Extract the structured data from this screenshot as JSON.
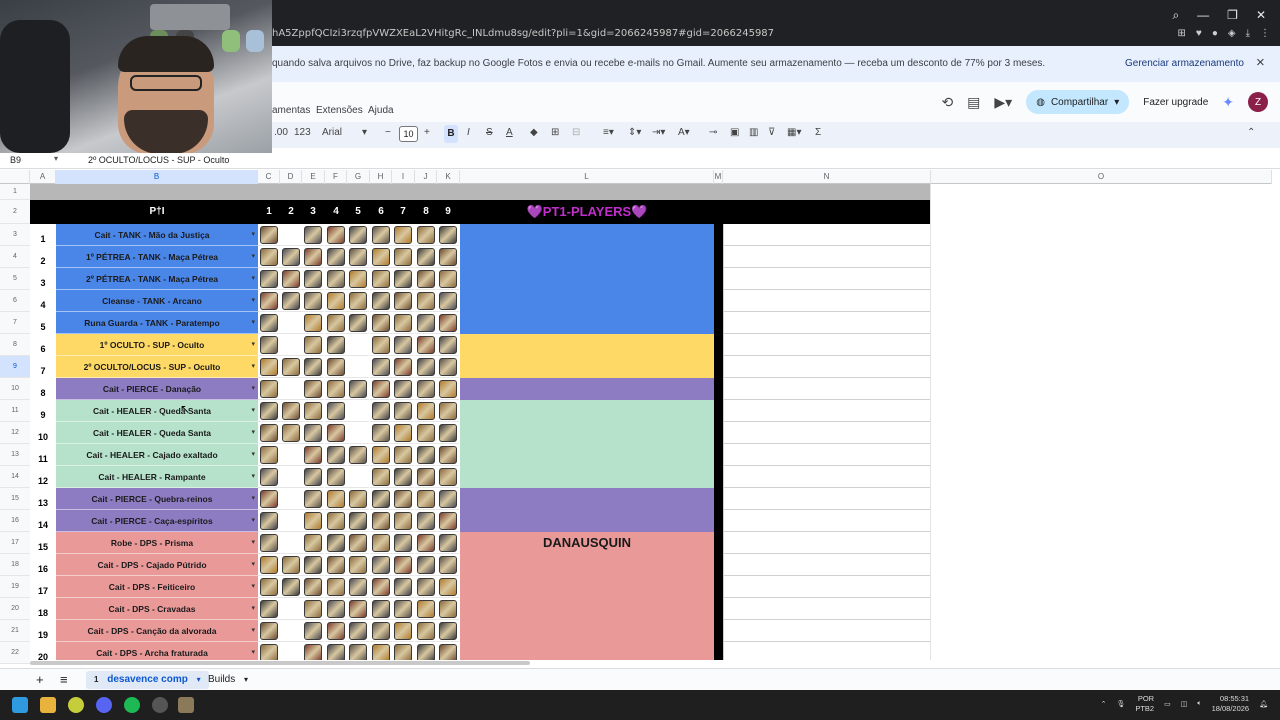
{
  "browser": {
    "url": "hA5ZppfQCIzi3rzqfpVWZXEaL2VHitgRc_INLdmu8sg/edit?pli=1&gid=2066245987#gid=2066245987"
  },
  "banner": {
    "message": "quando salva arquivos no Drive, faz backup no Google Fotos e envia ou recebe e-mails no Gmail. Aumente seu armazenamento — receba um desconto de 77% por 3 meses.",
    "action": "Gerenciar armazenamento",
    "close_icon": "×"
  },
  "menu": {
    "items": [
      "amentas",
      "Extensões",
      "Ajuda"
    ],
    "share_label": "Compartilhar",
    "upgrade_label": "Fazer upgrade",
    "avatar_letter": "Z"
  },
  "toolbar": {
    "decimals": ".00",
    "format_123": "123",
    "font": "Arial",
    "font_size": "10",
    "bold": "B",
    "italic": "I",
    "strike": "S",
    "text_color": "A",
    "sum": "Σ"
  },
  "formula_bar": {
    "cell_ref": "B9",
    "content": "2º OCULTO/LOCUS - SUP - Oculto"
  },
  "columns": [
    {
      "label": "A"
    },
    {
      "label": "B"
    },
    {
      "label": "C"
    },
    {
      "label": "D"
    },
    {
      "label": "E"
    },
    {
      "label": "F"
    },
    {
      "label": "G"
    },
    {
      "label": "H"
    },
    {
      "label": "I"
    },
    {
      "label": "J"
    },
    {
      "label": "K"
    },
    {
      "label": "L"
    },
    {
      "label": "M"
    },
    {
      "label": "N"
    },
    {
      "label": "O"
    }
  ],
  "sheet": {
    "header_title": "P†I",
    "slot_headers": [
      "1",
      "2",
      "3",
      "4",
      "5",
      "6",
      "7",
      "8",
      "9"
    ],
    "party_title": "💜PT1-PLAYERS💜",
    "rows": [
      {
        "row": "3",
        "num": "1",
        "role": "Cait - TANK - Mão da Justiça",
        "color": "#4a86e8",
        "items": [
          1,
          0,
          1,
          1,
          1,
          1,
          1,
          1,
          1
        ],
        "player": ""
      },
      {
        "row": "4",
        "num": "2",
        "role": "1º PÉTREA - TANK - Maça Pétrea",
        "color": "#4a86e8",
        "items": [
          1,
          1,
          1,
          1,
          1,
          1,
          1,
          1,
          1
        ],
        "player": ""
      },
      {
        "row": "5",
        "num": "3",
        "role": "2º PÉTREA - TANK - Maça Pétrea",
        "color": "#4a86e8",
        "items": [
          1,
          1,
          1,
          1,
          1,
          1,
          1,
          1,
          1
        ],
        "player": ""
      },
      {
        "row": "6",
        "num": "4",
        "role": "Cleanse - TANK - Arcano",
        "color": "#4a86e8",
        "items": [
          1,
          1,
          1,
          1,
          1,
          1,
          1,
          1,
          1
        ],
        "player": ""
      },
      {
        "row": "7",
        "num": "5",
        "role": "Runa Guarda - TANK - Paratempo",
        "color": "#4a86e8",
        "items": [
          1,
          0,
          1,
          1,
          1,
          1,
          1,
          1,
          1
        ],
        "player": ""
      },
      {
        "row": "8",
        "num": "6",
        "role": "1º OCULTO - SUP - Oculto",
        "color": "#ffd966",
        "items": [
          1,
          0,
          1,
          1,
          0,
          1,
          1,
          1,
          1
        ],
        "player": ""
      },
      {
        "row": "9",
        "num": "7",
        "role": "2º OCULTO/LOCUS - SUP - Oculto",
        "color": "#ffd966",
        "items": [
          1,
          1,
          1,
          1,
          0,
          1,
          1,
          1,
          1
        ],
        "player": ""
      },
      {
        "row": "10",
        "num": "8",
        "role": "Cait - PIERCE - Danação",
        "color": "#8e7cc3",
        "items": [
          1,
          0,
          1,
          1,
          1,
          1,
          1,
          1,
          1
        ],
        "player": ""
      },
      {
        "row": "11",
        "num": "9",
        "role": "Cait - HEALER - Queda Santa",
        "color": "#b6e2cc",
        "items": [
          1,
          1,
          1,
          1,
          0,
          1,
          1,
          1,
          1
        ],
        "player": ""
      },
      {
        "row": "12",
        "num": "10",
        "role": "Cait - HEALER - Queda Santa",
        "color": "#b6e2cc",
        "items": [
          1,
          1,
          1,
          1,
          0,
          1,
          1,
          1,
          1
        ],
        "player": ""
      },
      {
        "row": "13",
        "num": "11",
        "role": "Cait - HEALER - Cajado exaltado",
        "color": "#b6e2cc",
        "items": [
          1,
          0,
          1,
          1,
          1,
          1,
          1,
          1,
          1
        ],
        "player": ""
      },
      {
        "row": "14",
        "num": "12",
        "role": "Cait - HEALER - Rampante",
        "color": "#b6e2cc",
        "items": [
          1,
          0,
          1,
          1,
          0,
          1,
          1,
          1,
          1
        ],
        "player": ""
      },
      {
        "row": "15",
        "num": "13",
        "role": "Cait - PIERCE - Quebra-reinos",
        "color": "#8e7cc3",
        "items": [
          1,
          0,
          1,
          1,
          1,
          1,
          1,
          1,
          1
        ],
        "player": ""
      },
      {
        "row": "16",
        "num": "14",
        "role": "Cait - PIERCE - Caça-espíritos",
        "color": "#8e7cc3",
        "items": [
          1,
          0,
          1,
          1,
          1,
          1,
          1,
          1,
          1
        ],
        "player": ""
      },
      {
        "row": "17",
        "num": "15",
        "role": "Robe - DPS - Prisma",
        "color": "#ea9999",
        "items": [
          1,
          0,
          1,
          1,
          1,
          1,
          1,
          1,
          1
        ],
        "player": "DANAUSQUIN"
      },
      {
        "row": "18",
        "num": "16",
        "role": "Cait - DPS - Cajado Pútrido",
        "color": "#ea9999",
        "items": [
          1,
          1,
          1,
          1,
          1,
          1,
          1,
          1,
          1
        ],
        "player": ""
      },
      {
        "row": "19",
        "num": "17",
        "role": "Cait - DPS - Feiticeiro",
        "color": "#ea9999",
        "items": [
          1,
          1,
          1,
          1,
          1,
          1,
          1,
          1,
          1
        ],
        "player": ""
      },
      {
        "row": "20",
        "num": "18",
        "role": "Cait - DPS - Cravadas",
        "color": "#ea9999",
        "items": [
          1,
          0,
          1,
          1,
          1,
          1,
          1,
          1,
          1
        ],
        "player": ""
      },
      {
        "row": "21",
        "num": "19",
        "role": "Cait - DPS - Canção da alvorada",
        "color": "#ea9999",
        "items": [
          1,
          0,
          1,
          1,
          1,
          1,
          1,
          1,
          1
        ],
        "player": ""
      },
      {
        "row": "22",
        "num": "20",
        "role": "Cait - DPS - Archa fraturada",
        "color": "#ea9999",
        "items": [
          1,
          0,
          1,
          1,
          1,
          1,
          1,
          1,
          1
        ],
        "player": ""
      }
    ]
  },
  "sheet_tabs": {
    "add_icon": "+",
    "list_icon": "≡",
    "tabs": [
      {
        "badge": "1",
        "label": "desavence comp",
        "active": true
      },
      {
        "label": "Builds",
        "active": false
      }
    ]
  },
  "taskbar": {
    "lang": "POR",
    "lang2": "PTB2",
    "time": "08:55:31",
    "date": "18/08/2026"
  }
}
